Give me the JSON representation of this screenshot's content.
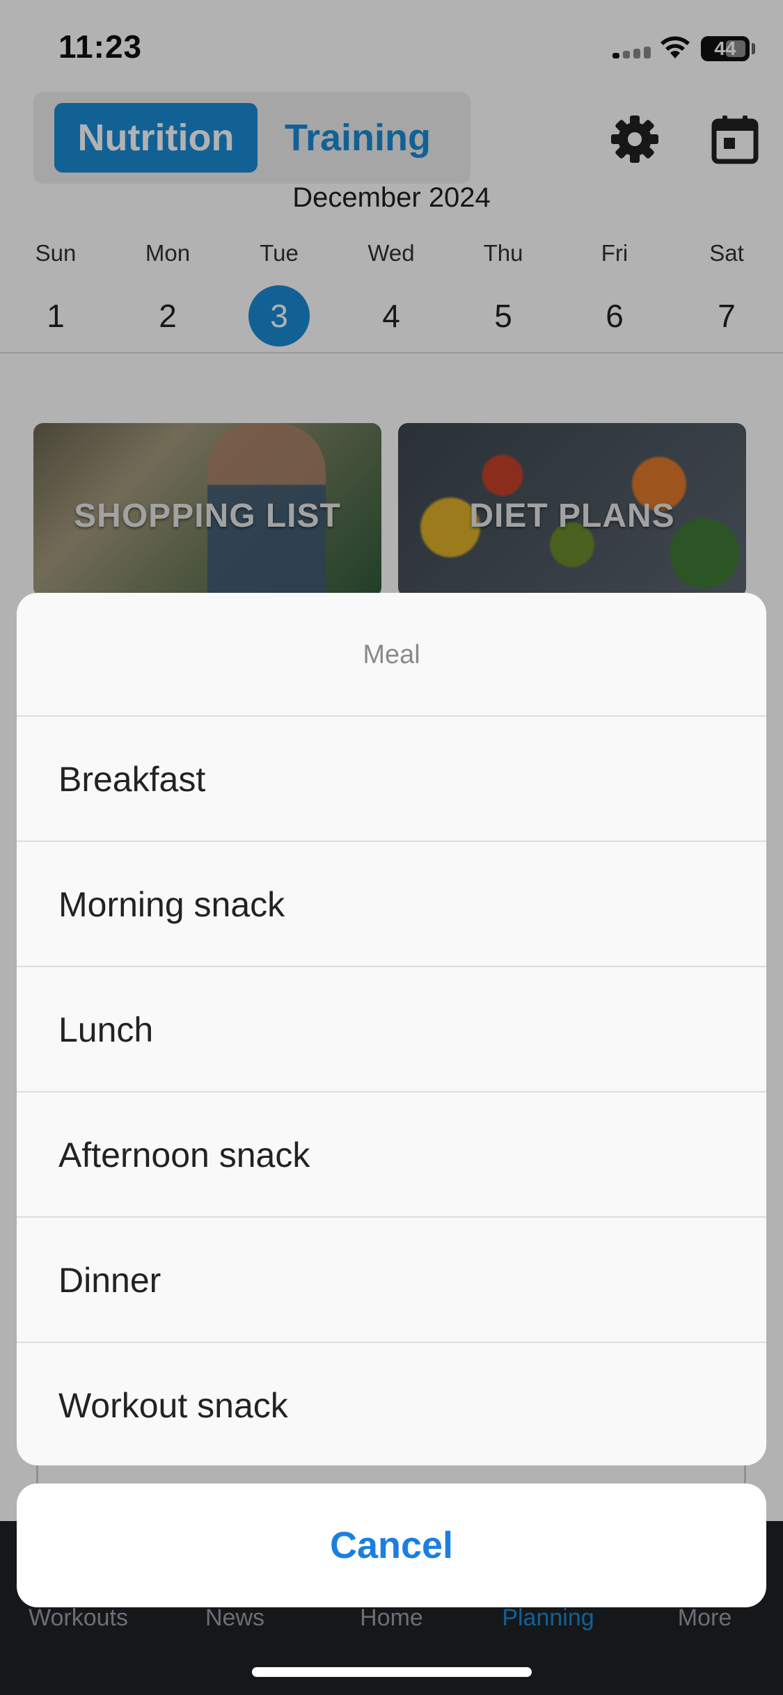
{
  "status_bar": {
    "time": "11:23",
    "battery": "44"
  },
  "header": {
    "tabs": [
      {
        "label": "Nutrition",
        "active": true
      },
      {
        "label": "Training",
        "active": false
      }
    ],
    "icons": [
      "gear-icon",
      "calendar-icon"
    ]
  },
  "calendar": {
    "month": "December 2024",
    "days": [
      {
        "name": "Sun",
        "num": "1"
      },
      {
        "name": "Mon",
        "num": "2"
      },
      {
        "name": "Tue",
        "num": "3",
        "selected": true
      },
      {
        "name": "Wed",
        "num": "4"
      },
      {
        "name": "Thu",
        "num": "5"
      },
      {
        "name": "Fri",
        "num": "6"
      },
      {
        "name": "Sat",
        "num": "7"
      }
    ]
  },
  "cards": {
    "shopping": "SHOPPING LIST",
    "diet": "DIET PLANS"
  },
  "bottom_nav": {
    "items": [
      "Workouts",
      "News",
      "Home",
      "Planning",
      "More"
    ],
    "active": "Planning"
  },
  "sheet": {
    "title": "Meal",
    "options": [
      "Breakfast",
      "Morning snack",
      "Lunch",
      "Afternoon snack",
      "Dinner",
      "Workout snack"
    ],
    "cancel": "Cancel"
  },
  "colors": {
    "accent": "#1b8bd6",
    "cancel": "#1a7fe0",
    "nav_bg": "#1f2125"
  }
}
